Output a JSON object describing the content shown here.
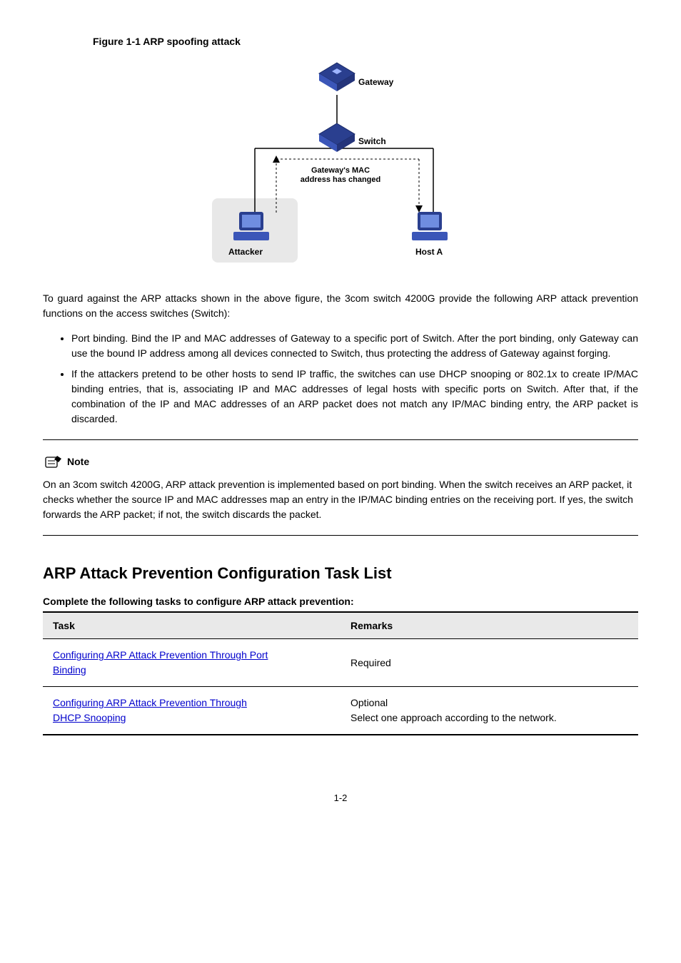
{
  "figure": {
    "caption": "Figure 1-1 ARP spoofing attack",
    "gateway_label": "Gateway",
    "switch_label": "Switch",
    "attacker_label": "Attacker",
    "hosta_label": "Host A",
    "msg_line1": "Gateway's MAC",
    "msg_line2": "address has changed"
  },
  "body": {
    "para1": "To guard against the ARP attacks shown in the above figure, the 3com switch 4200G provide the following ARP attack prevention functions on the access switches (Switch):",
    "bullet1": "Port binding. Bind the IP and MAC addresses of Gateway to a specific port of Switch. After the port binding, only Gateway can use the bound IP address among all devices connected to Switch, thus protecting the address of Gateway against forging.",
    "bullet2": "If the attackers pretend to be other hosts to send IP traffic, the switches can use DHCP snooping or 802.1x to create IP/MAC binding entries, that is, associating IP and MAC addresses of legal hosts with specific ports on Switch. After that, if the combination of the IP and MAC addresses of an ARP packet does not match any IP/MAC binding entry, the ARP packet is discarded."
  },
  "note": {
    "heading": "Note",
    "text": "On an 3com switch 4200G, ARP attack prevention is implemented based on port binding. When the switch receives an ARP packet, it checks whether the source IP and MAC addresses map an entry in the IP/MAC binding entries on the receiving port. If yes, the switch forwards the ARP packet; if not, the switch discards the packet."
  },
  "h2": "ARP Attack Prevention Configuration Task List",
  "table": {
    "caption": "Complete the following tasks to configure ARP attack prevention:",
    "head_task": "Task",
    "head_remarks": "Remarks",
    "row1_task_a": "Configuring ARP Attack Prevention Through Port",
    "row1_task_b": "Binding",
    "row1_remarks": "Required",
    "row2_task_a": "Configuring ARP Attack Prevention Through",
    "row2_task_b": "DHCP Snooping",
    "row2_remarks": "Optional",
    "row2_remarks2": "Select one approach according to the network."
  },
  "page_number": "1-2"
}
